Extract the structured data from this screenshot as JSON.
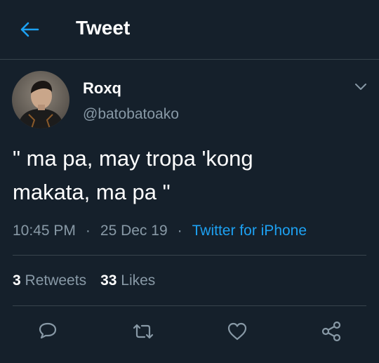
{
  "header": {
    "title": "Tweet",
    "back_icon": "arrow-left-icon"
  },
  "colors": {
    "background": "#15202b",
    "accent": "#1da1f2",
    "secondary_text": "#8899a6",
    "divider": "#38444d"
  },
  "author": {
    "name": "Roxq",
    "handle": "@batobatoako",
    "menu_icon": "chevron-down-icon"
  },
  "tweet": {
    "line1": "\" ma pa, may tropa 'kong",
    "line2": "makata, ma pa \""
  },
  "meta": {
    "time": "10:45 PM",
    "date": "25 Dec 19",
    "separator": "·",
    "source": "Twitter for iPhone"
  },
  "stats": {
    "retweets_count": "3",
    "retweets_label": "Retweets",
    "likes_count": "33",
    "likes_label": "Likes"
  },
  "actions": [
    "reply-icon",
    "retweet-icon",
    "like-icon",
    "share-icon"
  ]
}
